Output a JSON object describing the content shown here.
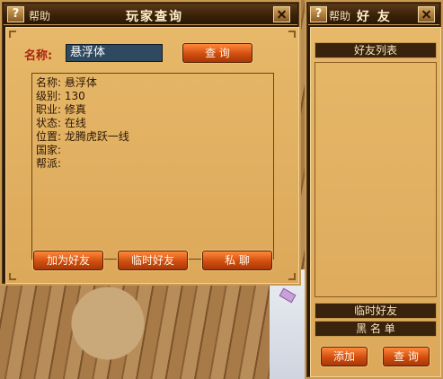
{
  "query_window": {
    "help_label": "帮助",
    "title": "玩家查询",
    "name_label": "名称:",
    "name_value": "悬浮体",
    "query_button": "查 询",
    "info_lines": [
      "名称: 悬浮体",
      "级别: 130",
      "职业: 修真",
      "状态: 在线",
      "位置: 龙腾虎跃一线",
      "国家:",
      "帮派:"
    ],
    "add_friend_button": "加为好友",
    "temp_friend_button": "临时好友",
    "private_chat_button": "私 聊"
  },
  "friends_window": {
    "help_label": "帮助",
    "title": "好 友",
    "friend_list_header": "好友列表",
    "temp_friends_header": "临时好友",
    "blacklist_header": "黑 名 单",
    "add_button": "添加",
    "query_button": "查 询"
  },
  "colors": {
    "panel": "#dca85a",
    "frame_dark": "#2a1b0d",
    "button_orange": "#d14e10",
    "input_bg": "#2f4a60",
    "label_red": "#a8250f"
  }
}
